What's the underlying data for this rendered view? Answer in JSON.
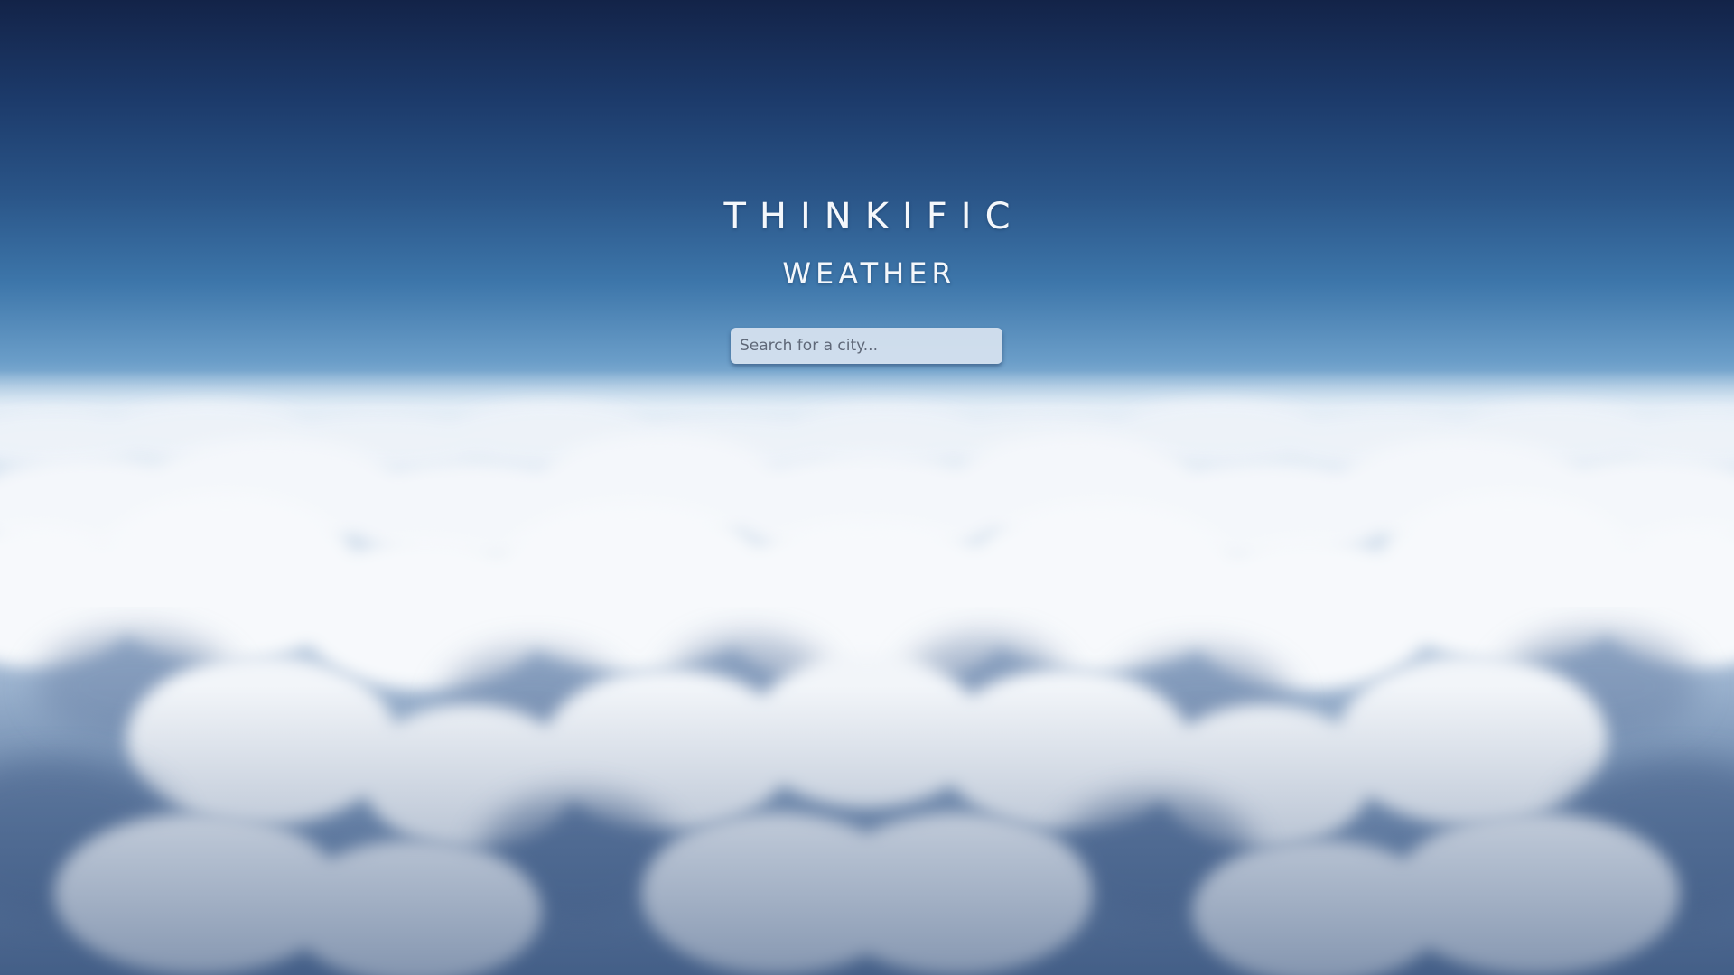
{
  "app": {
    "brand": "THINKIFIC",
    "subtitle": "WEATHER"
  },
  "search": {
    "placeholder": "Search for a city...",
    "value": ""
  },
  "background": {
    "description_icon": "clouds-above-horizon",
    "colors": {
      "sky_top": "#132348",
      "sky_mid": "#3d76aa",
      "horizon": "#cfdfee",
      "cloud_white": "#f2f5f9",
      "cloud_shadow": "#5c769c"
    }
  }
}
